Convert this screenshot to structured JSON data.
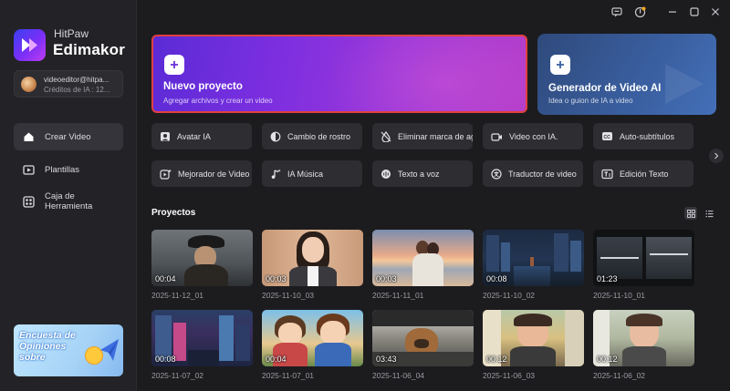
{
  "app": {
    "brand_top": "HitPaw",
    "brand_main": "Edimakor"
  },
  "account": {
    "email": "videoeditor@hitpa...",
    "credits": "Créditos de IA : 12..."
  },
  "sidebar": {
    "items": [
      {
        "label": "Crear Video",
        "icon": "home-icon",
        "active": true
      },
      {
        "label": "Plantillas",
        "icon": "templates-icon",
        "active": false
      },
      {
        "label": "Caja de Herramienta",
        "icon": "toolbox-icon",
        "active": false
      }
    ],
    "survey_label": "Encuesta de Opiniones sobre"
  },
  "hero": {
    "new_project": {
      "title": "Nuevo proyecto",
      "subtitle": "Agregar archivos y crear un video"
    },
    "ai_generator": {
      "title": "Generador de Video AI",
      "subtitle": "Idea o guion de IA a video"
    }
  },
  "tools": [
    {
      "label": "Avatar IA",
      "icon": "avatar-icon"
    },
    {
      "label": "Cambio de rostro",
      "icon": "face-swap-icon"
    },
    {
      "label": "Eliminar marca de agua",
      "icon": "watermark-remove-icon"
    },
    {
      "label": "Video con IA.",
      "icon": "ai-video-icon"
    },
    {
      "label": "Auto-subtítulos",
      "icon": "subtitles-icon"
    },
    {
      "label": "Mejorador de Video",
      "icon": "video-enhancer-icon"
    },
    {
      "label": "IA Música",
      "icon": "music-icon"
    },
    {
      "label": "Texto a voz",
      "icon": "text-to-speech-icon"
    },
    {
      "label": "Traductor de video",
      "icon": "translate-icon"
    },
    {
      "label": "Edición Texto",
      "icon": "text-edit-icon"
    }
  ],
  "projects_section": {
    "title": "Proyectos"
  },
  "projects": [
    {
      "name": "2025-11-12_01",
      "duration": "00:04"
    },
    {
      "name": "2025-11-10_03",
      "duration": "00:03"
    },
    {
      "name": "2025-11-11_01",
      "duration": "00:03"
    },
    {
      "name": "2025-11-10_02",
      "duration": "00:08"
    },
    {
      "name": "2025-11-10_01",
      "duration": "01:23"
    },
    {
      "name": "2025-11-07_02",
      "duration": "00:08"
    },
    {
      "name": "2025-11-07_01",
      "duration": "00:04"
    },
    {
      "name": "2025-11-06_04",
      "duration": "03:43"
    },
    {
      "name": "2025-11-06_03",
      "duration": "00:12"
    },
    {
      "name": "2025-11-06_02",
      "duration": "00:12"
    }
  ],
  "colors": {
    "accent_purple": "#7e2fe0",
    "highlight_border": "#e0403f",
    "ai_card_blue": "#3a5fa0",
    "sidebar_bg": "#232327",
    "main_bg": "#1c1c1f"
  }
}
